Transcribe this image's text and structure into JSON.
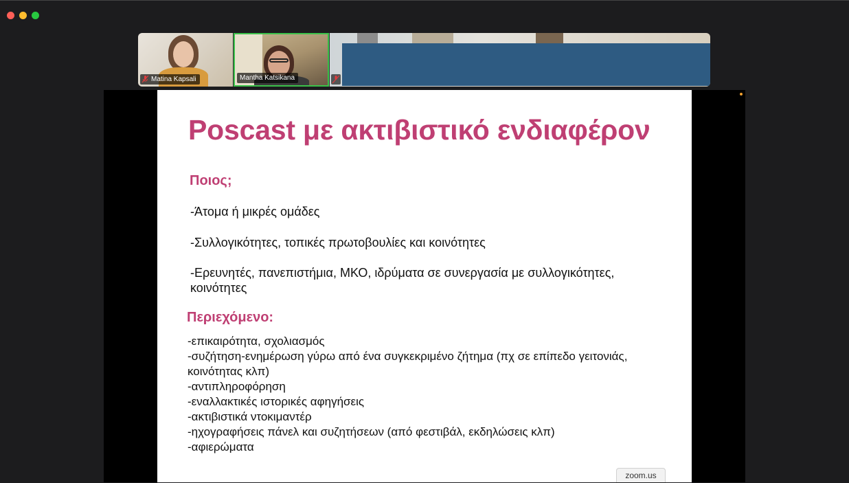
{
  "window": {
    "controls": [
      "close",
      "minimize",
      "zoom"
    ]
  },
  "participants": [
    {
      "name": "Matina Kapsali",
      "mic": "muted"
    },
    {
      "name": "Mantha Katsikana",
      "mic": "active",
      "active_speaker": true
    },
    {
      "name": "",
      "mic": "muted"
    }
  ],
  "slide": {
    "title": "Poscast με ακτιβιστικό ενδιαφέρον",
    "section1": {
      "heading": "Ποιος;",
      "items": [
        "-Άτομα ή μικρές ομάδες",
        "-Συλλογικότητες, τοπικές πρωτοβουλίες και κοινότητες",
        "-Ερευνητές, πανεπιστήμια, ΜΚΟ, ιδρύματα σε συνεργασία με συλλογικότητες,",
        "κοινότητες"
      ]
    },
    "section2": {
      "heading": "Περιεχόμενο:",
      "items": [
        "-επικαιρότητα, σχολιασμός",
        "-συζήτηση-ενημέρωση γύρω από ένα συγκεκριμένο ζήτημα (πχ σε επίπεδο γειτονιάς,",
        "κοινότητας κλπ)",
        "-αντιπληροφόρηση",
        "-εναλλακτικές ιστορικές αφηγήσεις",
        "-ακτιβιστικά ντοκιμαντέρ",
        "-ηχογραφήσεις πάνελ και συζητήσεων (από φεστιβάλ, εκδηλώσεις κλπ)",
        "-αφιερώματα"
      ]
    }
  },
  "footer": {
    "badge": "zoom.us"
  },
  "colors": {
    "accent": "#bf3f73",
    "active_speaker_border": "#3bc14a",
    "screen_share_overlay": "#2e5b82"
  }
}
